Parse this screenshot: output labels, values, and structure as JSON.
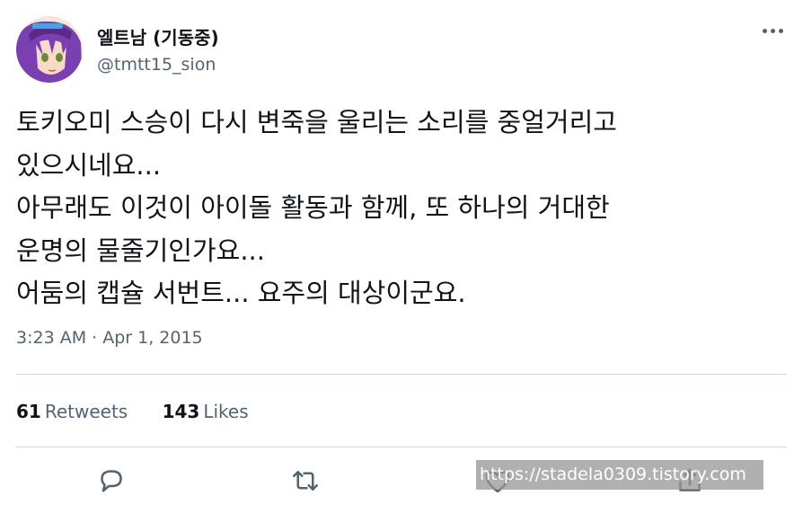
{
  "author": {
    "display_name": "엘트남 (기동중)",
    "handle": "@tmtt15_sion"
  },
  "tweet": {
    "lines": [
      "토키오미 스승이 다시 변죽을 울리는 소리를 중얼거리고",
      "있으시네요...",
      "아무래도 이것이 아이돌 활동과 함께, 또 하나의 거대한",
      "운명의 물줄기인가요...",
      "어둠의 캡슐 서번트... 요주의 대상이군요."
    ],
    "timestamp": "3:23 AM · Apr 1, 2015"
  },
  "stats": {
    "retweets_count": "61",
    "retweets_label": "Retweets",
    "likes_count": "143",
    "likes_label": "Likes"
  },
  "icons": {
    "more": "more-dots-icon",
    "reply": "reply-bubble-icon",
    "retweet": "retweet-arrows-icon",
    "like": "heart-icon",
    "share": "share-upload-icon"
  },
  "colors": {
    "text_primary": "#0f1419",
    "text_secondary": "#536471",
    "divider": "#cfd9de",
    "avatar_hair": "#7a3fb0"
  },
  "watermark": "https://stadela0309.tistory.com"
}
